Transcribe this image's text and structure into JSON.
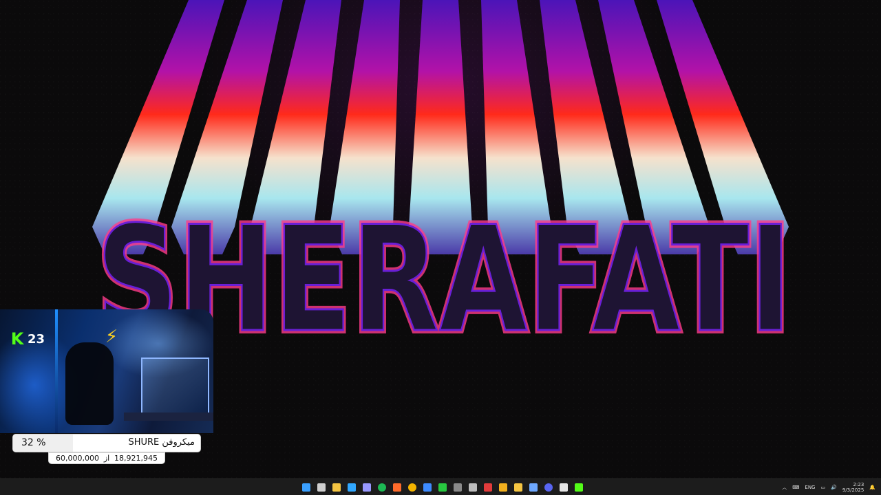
{
  "wallpaper": {
    "headline": "SHERAFATI",
    "colors": {
      "violet": "#6a1fd6",
      "magenta": "#e0146e",
      "red": "#ff2a1a",
      "cream": "#f3e3cf",
      "ice": "#a8e6ee",
      "letter_fill": "#1e1433"
    }
  },
  "stream_overlay": {
    "platform_icon": "kick-logo-icon",
    "viewer_count": "23",
    "sign_icon": "lightning-bolt-icon",
    "goal": {
      "title": "میکروفن SHURE",
      "percent_label": "32 %",
      "progress": 0.32,
      "current": "18,921,945",
      "of_label": "از",
      "target": "60,000,000"
    }
  },
  "taskbar": {
    "icons": [
      {
        "name": "start-icon",
        "color": "#3aa0ff"
      },
      {
        "name": "task-view-icon",
        "color": "#cfcfcf"
      },
      {
        "name": "file-explorer-icon",
        "color": "#f5c542"
      },
      {
        "name": "photoshop-icon",
        "color": "#31a8ff"
      },
      {
        "name": "premiere-icon",
        "color": "#9999ff"
      },
      {
        "name": "spotify-icon",
        "color": "#1db954"
      },
      {
        "name": "app-orange-icon",
        "color": "#ff6b2b"
      },
      {
        "name": "chrome-icon",
        "color": "#f4b400"
      },
      {
        "name": "app-blue-icon",
        "color": "#3d8bff"
      },
      {
        "name": "app-green-icon",
        "color": "#28c840"
      },
      {
        "name": "app-dark-icon",
        "color": "#8a8a8a"
      },
      {
        "name": "app-grid-icon",
        "color": "#bdbdbd"
      },
      {
        "name": "app-red-icon",
        "color": "#e23b3b"
      },
      {
        "name": "app-yellow-icon",
        "color": "#f2b01e"
      },
      {
        "name": "app-bag-icon",
        "color": "#f5c542"
      },
      {
        "name": "app-cloud-icon",
        "color": "#6ea8ff"
      },
      {
        "name": "discord-icon",
        "color": "#5865f2"
      },
      {
        "name": "app-window-icon",
        "color": "#e6e6e6"
      },
      {
        "name": "app-kick-icon",
        "color": "#53fc18"
      }
    ],
    "tray": {
      "language": "ENG",
      "time": "2:23",
      "date": "9/3/2025"
    }
  }
}
